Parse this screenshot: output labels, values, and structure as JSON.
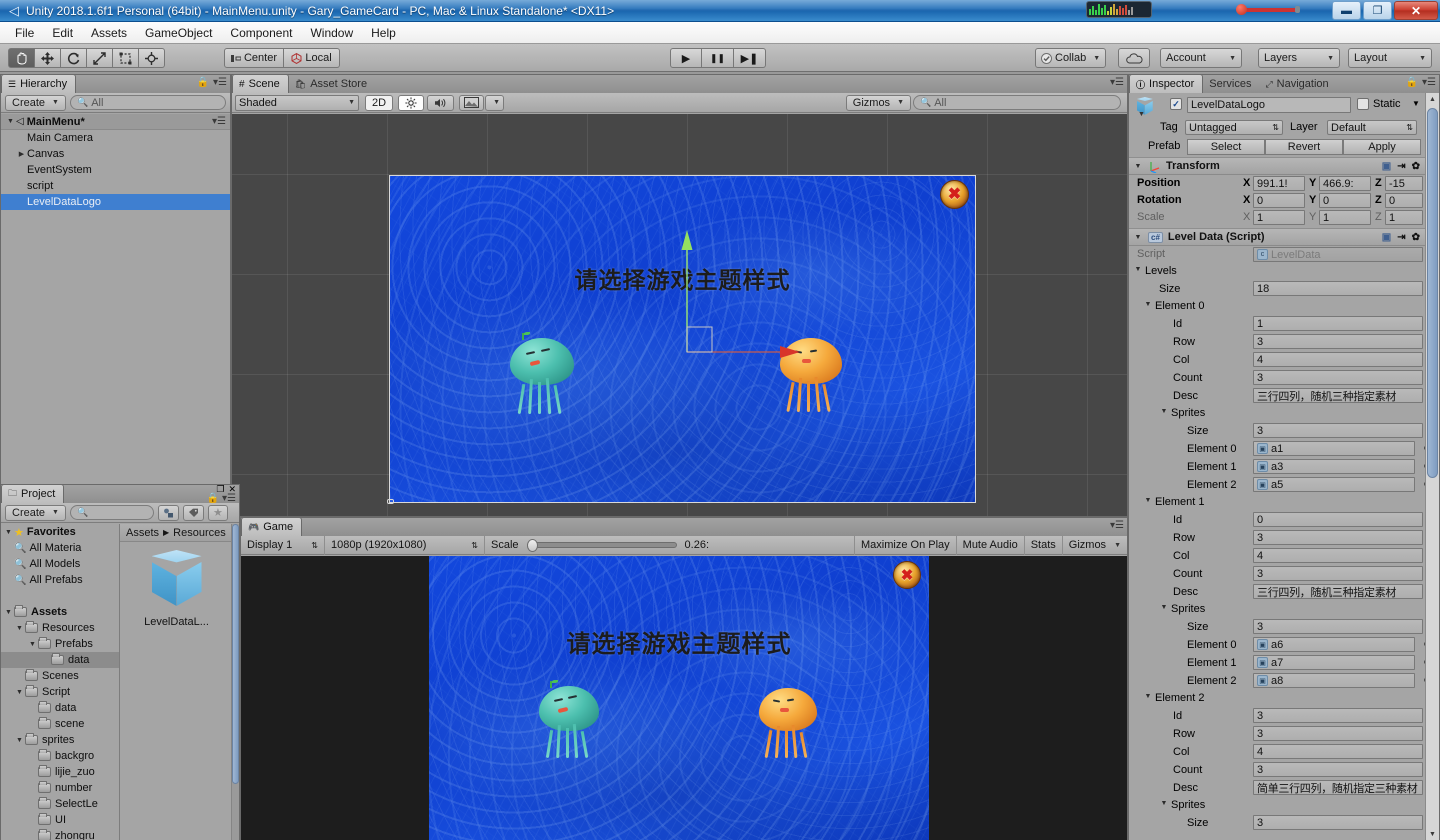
{
  "window": {
    "title": "Unity 2018.1.6f1 Personal (64bit) - MainMenu.unity - Gary_GameCard - PC, Mac & Linux Standalone* <DX11>",
    "icon": "unity-icon",
    "minimize_label": "▬",
    "maximize_label": "❐",
    "close_label": "✕"
  },
  "menubar": {
    "items": [
      {
        "label": "File"
      },
      {
        "label": "Edit"
      },
      {
        "label": "Assets"
      },
      {
        "label": "GameObject"
      },
      {
        "label": "Component"
      },
      {
        "label": "Window"
      },
      {
        "label": "Help"
      }
    ]
  },
  "toolbar": {
    "transform_tools": [
      {
        "name": "hand-tool",
        "active": true
      },
      {
        "name": "move-tool",
        "active": false
      },
      {
        "name": "rotate-tool",
        "active": false
      },
      {
        "name": "scale-tool",
        "active": false
      },
      {
        "name": "rect-tool",
        "active": false
      },
      {
        "name": "transform-tool",
        "active": false
      }
    ],
    "pivot_mode": "Center",
    "pivot_rotation": "Local",
    "play_label": "▶",
    "pause_label": "❚❚",
    "step_label": "▶❚",
    "collab_label": "Collab",
    "cloud_label": "cloud-icon",
    "account_label": "Account",
    "layers_label": "Layers",
    "layout_label": "Layout"
  },
  "hierarchy": {
    "tab_label": "Hierarchy",
    "create_label": "Create",
    "search_placeholder": "All",
    "scene_name": "MainMenu*",
    "items": [
      {
        "label": "Main Camera",
        "indent": 1,
        "expandable": false,
        "selected": false
      },
      {
        "label": "Canvas",
        "indent": 1,
        "expandable": true,
        "selected": false
      },
      {
        "label": "EventSystem",
        "indent": 1,
        "expandable": false,
        "selected": false
      },
      {
        "label": "script",
        "indent": 1,
        "expandable": false,
        "selected": false
      },
      {
        "label": "LevelDataLogo",
        "indent": 1,
        "expandable": false,
        "selected": true
      }
    ]
  },
  "scene_view": {
    "tabs": [
      {
        "label": "Scene",
        "active": true,
        "icon": "grid-icon"
      },
      {
        "label": "Asset Store",
        "active": false,
        "icon": "store-icon"
      }
    ],
    "draw_mode": "Shaded",
    "mode_2d": "2D",
    "lighting_icon": "sun-icon",
    "audio_icon": "speaker-icon",
    "effects_icon": "image-icon",
    "gizmos_label": "Gizmos",
    "search_placeholder": "All"
  },
  "game_content": {
    "title_text": "请选择游戏主题样式",
    "close_button_label": "✖",
    "jellyfish": [
      {
        "name": "teal-jellyfish",
        "color": "#4cbfae"
      },
      {
        "name": "orange-jellyfish",
        "color": "#f5a93c"
      }
    ],
    "background_color": "#1348dd"
  },
  "inspector": {
    "tabs": [
      {
        "label": "Inspector",
        "active": true,
        "icon": "info-icon"
      },
      {
        "label": "Services",
        "active": false,
        "icon": ""
      },
      {
        "label": "Navigation",
        "active": false,
        "icon": "navigation-icon"
      }
    ],
    "object_name": "LevelDataLogo",
    "object_enabled": true,
    "static_label": "Static",
    "tag_label": "Tag",
    "tag_value": "Untagged",
    "layer_label": "Layer",
    "layer_value": "Default",
    "prefab_label": "Prefab",
    "prefab_buttons": [
      "Select",
      "Revert",
      "Apply"
    ],
    "transform": {
      "header": "Transform",
      "rows": [
        {
          "label": "Position",
          "x": "991.1!",
          "y": "466.9:",
          "z": "-15",
          "disabled": false
        },
        {
          "label": "Rotation",
          "x": "0",
          "y": "0",
          "z": "0",
          "disabled": false
        },
        {
          "label": "Scale",
          "x": "1",
          "y": "1",
          "z": "1",
          "disabled": true
        }
      ]
    },
    "level_data": {
      "header": "Level Data (Script)",
      "script_label": "Script",
      "script_value": "LevelData",
      "levels_label": "Levels",
      "size_label": "Size",
      "size_value": "18",
      "elements": [
        {
          "label": "Element 0",
          "fields": [
            {
              "label": "Id",
              "value": "1"
            },
            {
              "label": "Row",
              "value": "3"
            },
            {
              "label": "Col",
              "value": "4"
            },
            {
              "label": "Count",
              "value": "3"
            },
            {
              "label": "Desc",
              "value": "三行四列，随机三种指定素材",
              "cjk": true
            }
          ],
          "sprites_label": "Sprites",
          "sprites_size_label": "Size",
          "sprites_size_value": "3",
          "sprites": [
            {
              "label": "Element 0",
              "value": "a1"
            },
            {
              "label": "Element 1",
              "value": "a3"
            },
            {
              "label": "Element 2",
              "value": "a5"
            }
          ]
        },
        {
          "label": "Element 1",
          "fields": [
            {
              "label": "Id",
              "value": "0"
            },
            {
              "label": "Row",
              "value": "3"
            },
            {
              "label": "Col",
              "value": "4"
            },
            {
              "label": "Count",
              "value": "3"
            },
            {
              "label": "Desc",
              "value": "三行四列，随机三种指定素材",
              "cjk": true
            }
          ],
          "sprites_label": "Sprites",
          "sprites_size_label": "Size",
          "sprites_size_value": "3",
          "sprites": [
            {
              "label": "Element 0",
              "value": "a6"
            },
            {
              "label": "Element 1",
              "value": "a7"
            },
            {
              "label": "Element 2",
              "value": "a8"
            }
          ]
        },
        {
          "label": "Element 2",
          "fields": [
            {
              "label": "Id",
              "value": "3"
            },
            {
              "label": "Row",
              "value": "3"
            },
            {
              "label": "Col",
              "value": "4"
            },
            {
              "label": "Count",
              "value": "3"
            },
            {
              "label": "Desc",
              "value": "简单三行四列，随机指定三种素材",
              "cjk": true
            }
          ],
          "sprites_label": "Sprites",
          "sprites_size_label": "Size",
          "sprites_size_value": "3",
          "sprites": []
        }
      ]
    }
  },
  "project": {
    "tab_label": "Project",
    "create_label": "Create",
    "search_placeholder": "",
    "breadcrumb": [
      "Assets",
      "Resources"
    ],
    "tree": [
      {
        "label": "Favorites",
        "indent": 0,
        "arrow": "▼",
        "icon": "star",
        "bold": true,
        "selected": false
      },
      {
        "label": "All Materia",
        "indent": 1,
        "arrow": "",
        "icon": "search",
        "bold": false,
        "selected": false
      },
      {
        "label": "All Models",
        "indent": 1,
        "arrow": "",
        "icon": "search",
        "bold": false,
        "selected": false
      },
      {
        "label": "All Prefabs",
        "indent": 1,
        "arrow": "",
        "icon": "search",
        "bold": false,
        "selected": false
      },
      {
        "label": "",
        "indent": 0,
        "arrow": "",
        "icon": "none",
        "bold": false,
        "selected": false
      },
      {
        "label": "Assets",
        "indent": 0,
        "arrow": "▼",
        "icon": "folder",
        "bold": true,
        "selected": false
      },
      {
        "label": "Resources",
        "indent": 1,
        "arrow": "▼",
        "icon": "folder",
        "bold": false,
        "selected": false
      },
      {
        "label": "Prefabs",
        "indent": 2,
        "arrow": "▼",
        "icon": "folder",
        "bold": false,
        "selected": false
      },
      {
        "label": "data",
        "indent": 3,
        "arrow": "",
        "icon": "folder",
        "bold": false,
        "selected": true
      },
      {
        "label": "Scenes",
        "indent": 1,
        "arrow": "",
        "icon": "folder",
        "bold": false,
        "selected": false
      },
      {
        "label": "Script",
        "indent": 1,
        "arrow": "▼",
        "icon": "folder",
        "bold": false,
        "selected": false
      },
      {
        "label": "data",
        "indent": 2,
        "arrow": "",
        "icon": "folder",
        "bold": false,
        "selected": false
      },
      {
        "label": "scene",
        "indent": 2,
        "arrow": "",
        "icon": "folder",
        "bold": false,
        "selected": false
      },
      {
        "label": "sprites",
        "indent": 1,
        "arrow": "▼",
        "icon": "folder",
        "bold": false,
        "selected": false
      },
      {
        "label": "backgro",
        "indent": 2,
        "arrow": "",
        "icon": "folder",
        "bold": false,
        "selected": false
      },
      {
        "label": "lijie_zuo",
        "indent": 2,
        "arrow": "",
        "icon": "folder",
        "bold": false,
        "selected": false
      },
      {
        "label": "number",
        "indent": 2,
        "arrow": "",
        "icon": "folder",
        "bold": false,
        "selected": false
      },
      {
        "label": "SelectLe",
        "indent": 2,
        "arrow": "",
        "icon": "folder",
        "bold": false,
        "selected": false
      },
      {
        "label": "UI",
        "indent": 2,
        "arrow": "",
        "icon": "folder",
        "bold": false,
        "selected": false
      },
      {
        "label": "zhongru",
        "indent": 2,
        "arrow": "",
        "icon": "folder",
        "bold": false,
        "selected": false
      }
    ],
    "asset": {
      "label": "LevelDataL...",
      "icon": "prefab-cube-icon"
    }
  },
  "game_view": {
    "tab_label": "Game",
    "display_value": "Display 1",
    "resolution_value": "1080p (1920x1080)",
    "scale_label": "Scale",
    "scale_value": "0.26:",
    "maximize_label": "Maximize On Play",
    "mute_label": "Mute Audio",
    "stats_label": "Stats",
    "gizmos_label": "Gizmos"
  }
}
